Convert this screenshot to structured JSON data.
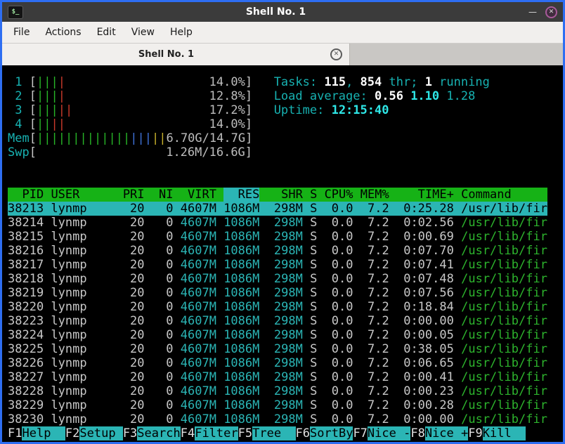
{
  "window": {
    "title": "Shell No. 1",
    "icon_glyph": "$_",
    "minimize_glyph": "—",
    "close_glyph": "✕"
  },
  "menu": {
    "items": [
      "File",
      "Actions",
      "Edit",
      "View",
      "Help"
    ]
  },
  "tab": {
    "label": "Shell No. 1",
    "close_glyph": "✕"
  },
  "palette": {
    "border_blue": "#2e6ef2",
    "header_green": "#16b216",
    "selection_cyan": "#2bb5b5",
    "text_cyan": "#17b2b2",
    "bright_cyan": "#2ee6e6",
    "value_teal": "#2bb5b5",
    "command_green": "#2db42d",
    "bar_colors": {
      "green": "#27b427",
      "red": "#c9392b",
      "blue": "#3f72d8",
      "yellow": "#c8b12b"
    }
  },
  "htop": {
    "meters": {
      "inner_width": 29,
      "cpus": [
        {
          "label": "1",
          "bars": [
            "green",
            "green",
            "green",
            "red"
          ],
          "text": "14.0%"
        },
        {
          "label": "2",
          "bars": [
            "green",
            "green",
            "green",
            "red"
          ],
          "text": "12.8%"
        },
        {
          "label": "3",
          "bars": [
            "green",
            "green",
            "green",
            "red",
            "red"
          ],
          "text": "17.2%"
        },
        {
          "label": "4",
          "bars": [
            "green",
            "green",
            "red",
            "red"
          ],
          "text": "14.0%"
        }
      ],
      "mem": {
        "label": "Mem",
        "bars": [
          "green",
          "green",
          "green",
          "green",
          "green",
          "green",
          "green",
          "green",
          "green",
          "green",
          "green",
          "green",
          "green",
          "blue",
          "blue",
          "blue",
          "yellow",
          "yellow"
        ],
        "text": "6.70G/14.7G"
      },
      "swp": {
        "label": "Swp",
        "bars": [],
        "text": "1.26M/16.6G"
      }
    },
    "stats": {
      "tasks": [
        [
          "c",
          "Tasks: "
        ],
        [
          "bw",
          "115"
        ],
        [
          "c",
          ", "
        ],
        [
          "bw",
          "854"
        ],
        [
          "c",
          " thr; "
        ],
        [
          "bw",
          "1"
        ],
        [
          "c",
          " running"
        ]
      ],
      "load": [
        [
          "c",
          "Load average: "
        ],
        [
          "bw",
          "0.56"
        ],
        [
          "f",
          " "
        ],
        [
          "bc",
          "1.10"
        ],
        [
          "f",
          " "
        ],
        [
          "c",
          "1.28"
        ]
      ],
      "uptime": [
        [
          "c",
          "Uptime: "
        ],
        [
          "bc",
          "12:15:40"
        ]
      ]
    },
    "table": {
      "columns": [
        {
          "header": "PID",
          "width": 5,
          "align": "right"
        },
        {
          "header": "USER",
          "width": 9,
          "align": "left"
        },
        {
          "header": "PRI",
          "width": 3,
          "align": "right"
        },
        {
          "header": "NI",
          "width": 3,
          "align": "right"
        },
        {
          "header": "VIRT",
          "width": 5,
          "align": "right",
          "color": "teal"
        },
        {
          "header": "RES",
          "width": 5,
          "align": "right",
          "color": "teal",
          "sorted": true
        },
        {
          "header": "SHR",
          "width": 5,
          "align": "right",
          "color": "teal"
        },
        {
          "header": "S",
          "width": 1,
          "align": "left"
        },
        {
          "header": "CPU%",
          "width": 4,
          "align": "right"
        },
        {
          "header": "MEM%",
          "width": 4,
          "align": "right"
        },
        {
          "header": "TIME+",
          "width": 8,
          "align": "right"
        },
        {
          "header": "Command",
          "width": 12,
          "align": "left",
          "color": "green"
        }
      ],
      "selected_index": 0,
      "rows": [
        [
          "38213",
          "lynmp",
          "20",
          "0",
          "4607M",
          "1086M",
          "298M",
          "S",
          "0.0",
          "7.2",
          "0:25.28",
          "/usr/lib/fir"
        ],
        [
          "38214",
          "lynmp",
          "20",
          "0",
          "4607M",
          "1086M",
          "298M",
          "S",
          "0.0",
          "7.2",
          "0:02.56",
          "/usr/lib/fir"
        ],
        [
          "38215",
          "lynmp",
          "20",
          "0",
          "4607M",
          "1086M",
          "298M",
          "S",
          "0.0",
          "7.2",
          "0:00.69",
          "/usr/lib/fir"
        ],
        [
          "38216",
          "lynmp",
          "20",
          "0",
          "4607M",
          "1086M",
          "298M",
          "S",
          "0.0",
          "7.2",
          "0:07.70",
          "/usr/lib/fir"
        ],
        [
          "38217",
          "lynmp",
          "20",
          "0",
          "4607M",
          "1086M",
          "298M",
          "S",
          "0.0",
          "7.2",
          "0:07.41",
          "/usr/lib/fir"
        ],
        [
          "38218",
          "lynmp",
          "20",
          "0",
          "4607M",
          "1086M",
          "298M",
          "S",
          "0.0",
          "7.2",
          "0:07.48",
          "/usr/lib/fir"
        ],
        [
          "38219",
          "lynmp",
          "20",
          "0",
          "4607M",
          "1086M",
          "298M",
          "S",
          "0.0",
          "7.2",
          "0:07.56",
          "/usr/lib/fir"
        ],
        [
          "38220",
          "lynmp",
          "20",
          "0",
          "4607M",
          "1086M",
          "298M",
          "S",
          "0.0",
          "7.2",
          "0:18.84",
          "/usr/lib/fir"
        ],
        [
          "38223",
          "lynmp",
          "20",
          "0",
          "4607M",
          "1086M",
          "298M",
          "S",
          "0.0",
          "7.2",
          "0:00.00",
          "/usr/lib/fir"
        ],
        [
          "38224",
          "lynmp",
          "20",
          "0",
          "4607M",
          "1086M",
          "298M",
          "S",
          "0.0",
          "7.2",
          "0:00.05",
          "/usr/lib/fir"
        ],
        [
          "38225",
          "lynmp",
          "20",
          "0",
          "4607M",
          "1086M",
          "298M",
          "S",
          "0.0",
          "7.2",
          "0:38.05",
          "/usr/lib/fir"
        ],
        [
          "38226",
          "lynmp",
          "20",
          "0",
          "4607M",
          "1086M",
          "298M",
          "S",
          "0.0",
          "7.2",
          "0:06.65",
          "/usr/lib/fir"
        ],
        [
          "38227",
          "lynmp",
          "20",
          "0",
          "4607M",
          "1086M",
          "298M",
          "S",
          "0.0",
          "7.2",
          "0:00.41",
          "/usr/lib/fir"
        ],
        [
          "38228",
          "lynmp",
          "20",
          "0",
          "4607M",
          "1086M",
          "298M",
          "S",
          "0.0",
          "7.2",
          "0:00.23",
          "/usr/lib/fir"
        ],
        [
          "38229",
          "lynmp",
          "20",
          "0",
          "4607M",
          "1086M",
          "298M",
          "S",
          "0.0",
          "7.2",
          "0:00.28",
          "/usr/lib/fir"
        ],
        [
          "38230",
          "lynmp",
          "20",
          "0",
          "4607M",
          "1086M",
          "298M",
          "S",
          "0.0",
          "7.2",
          "0:00.00",
          "/usr/lib/fir"
        ]
      ]
    },
    "fnkeys": [
      {
        "key": "F1",
        "label": "Help  "
      },
      {
        "key": "F2",
        "label": "Setup "
      },
      {
        "key": "F3",
        "label": "Search"
      },
      {
        "key": "F4",
        "label": "Filter"
      },
      {
        "key": "F5",
        "label": "Tree  "
      },
      {
        "key": "F6",
        "label": "SortBy"
      },
      {
        "key": "F7",
        "label": "Nice -"
      },
      {
        "key": "F8",
        "label": "Nice +"
      },
      {
        "key": "F9",
        "label": "Kill  "
      }
    ]
  }
}
